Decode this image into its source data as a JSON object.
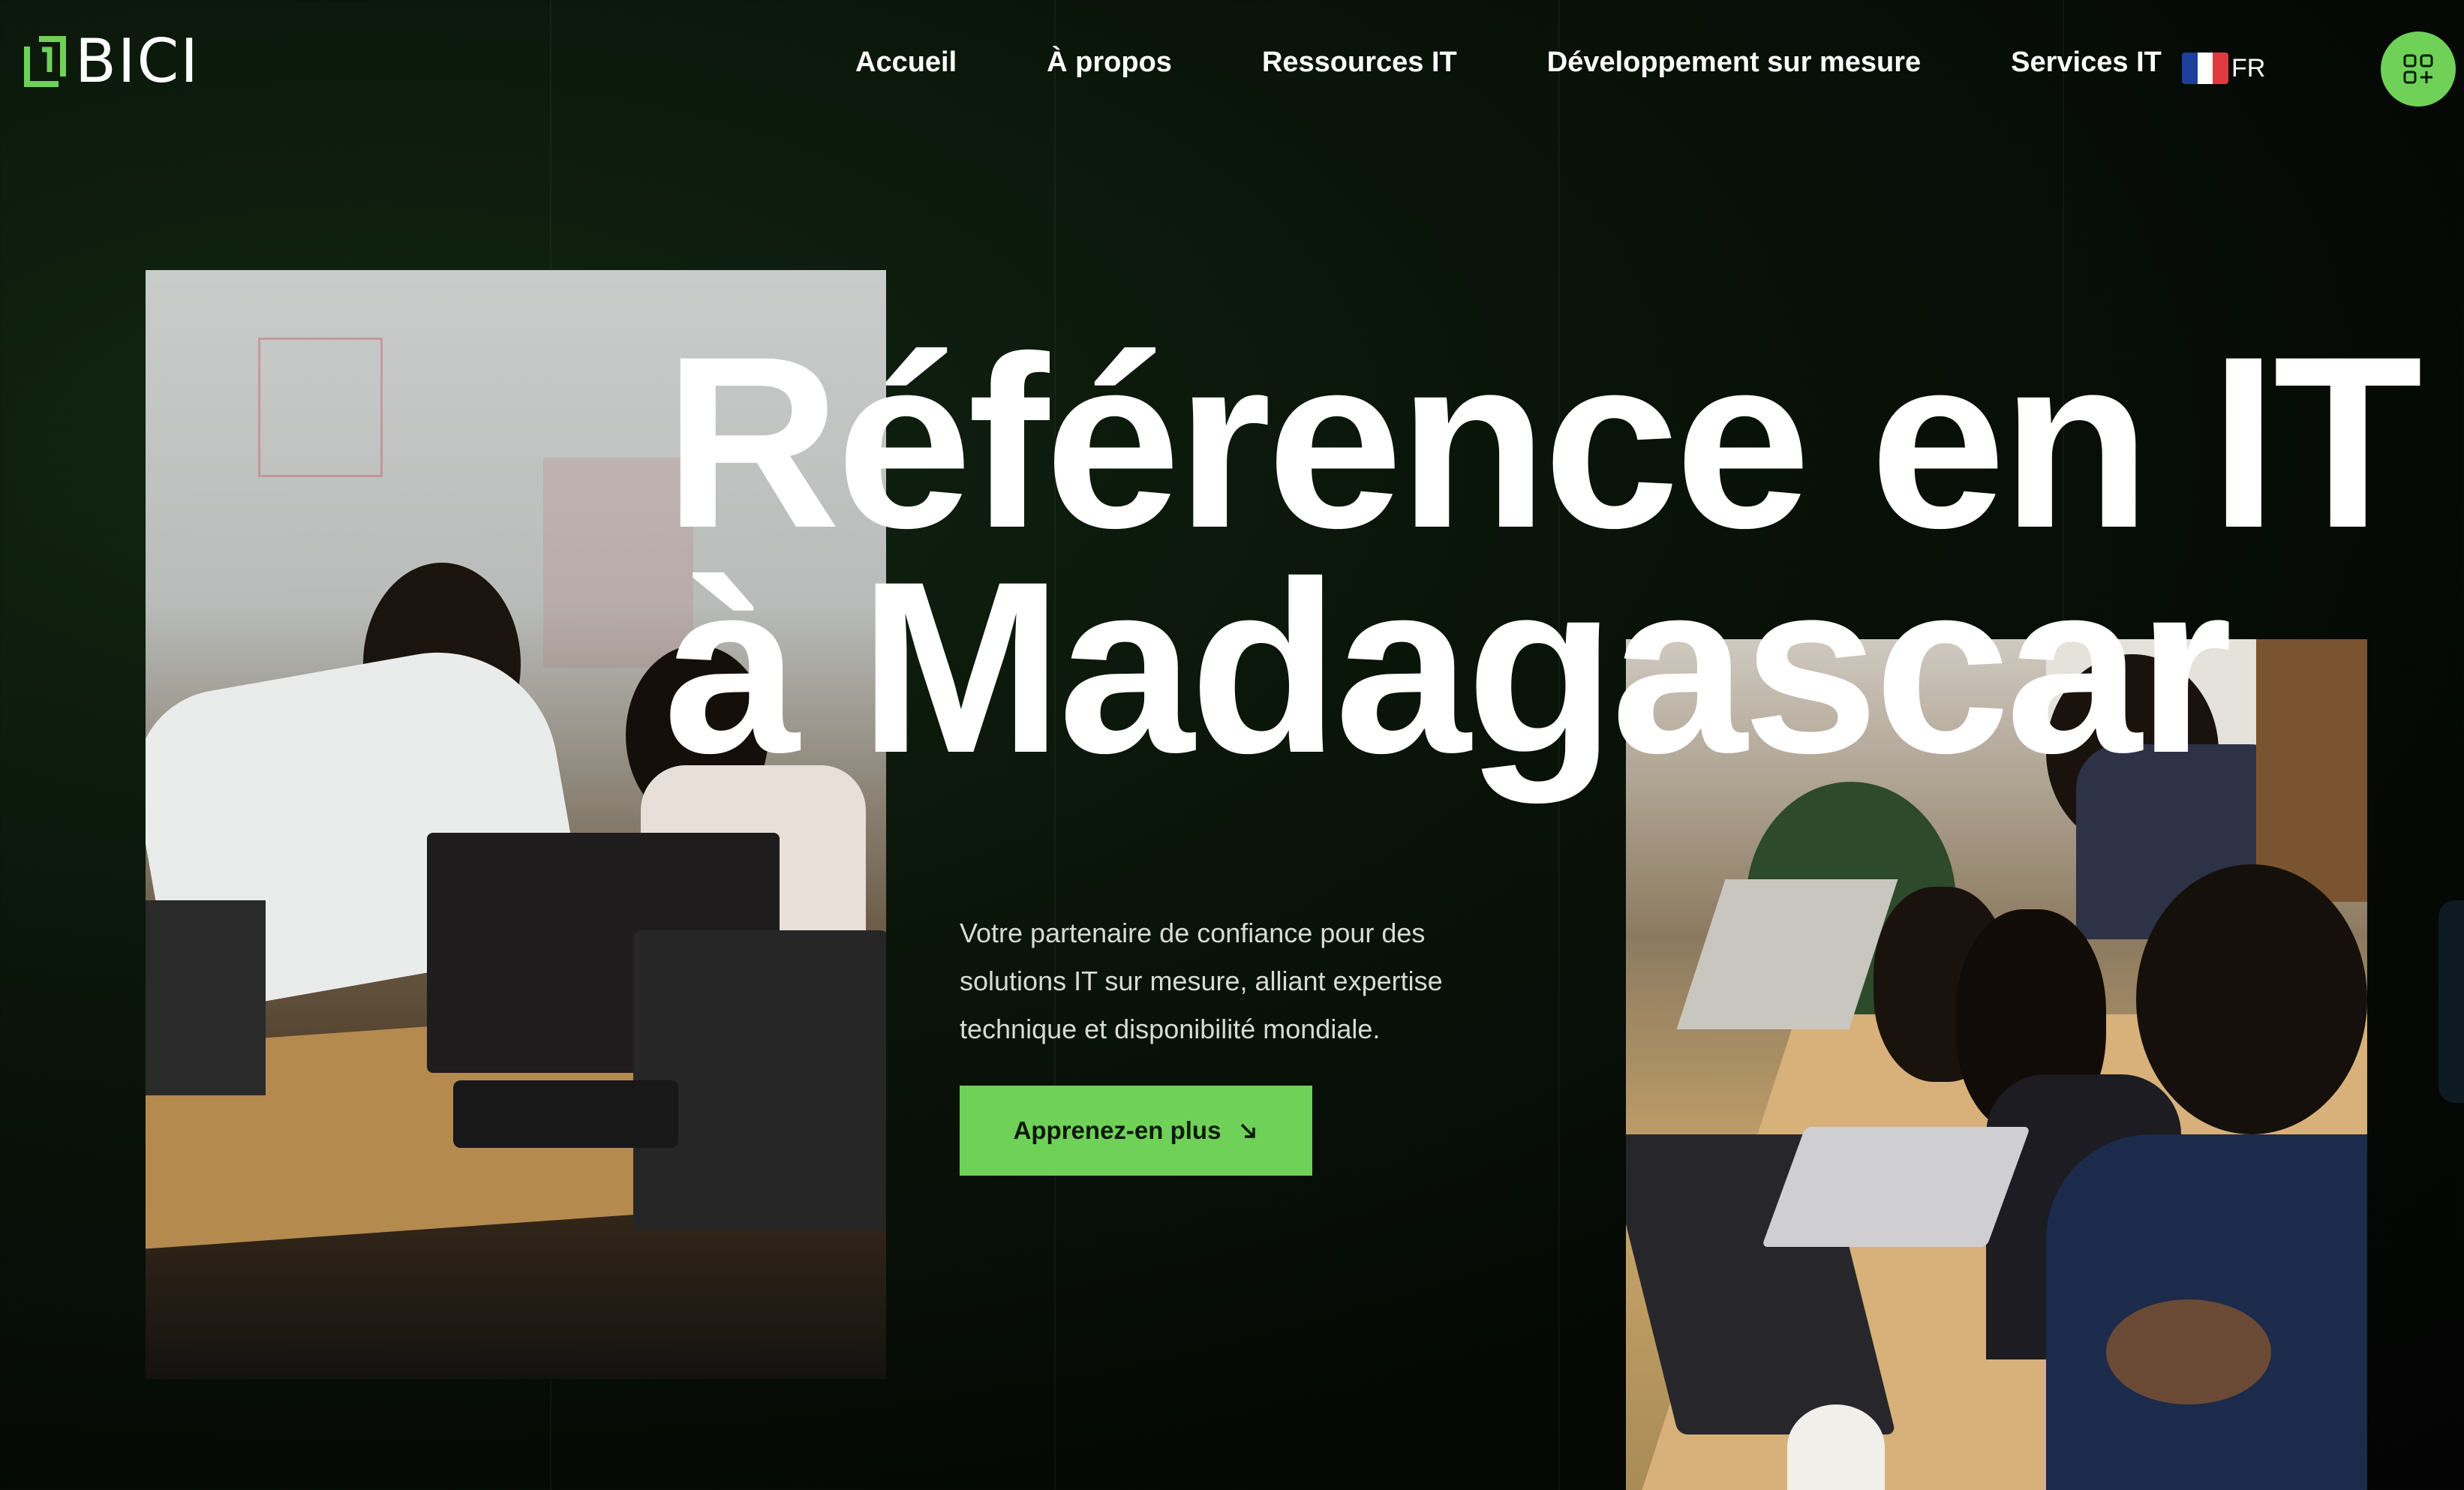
{
  "brand": {
    "name": "BICI",
    "logo_color": "#6fd158"
  },
  "nav": {
    "items": [
      {
        "label": "Accueil"
      },
      {
        "label": "À propos"
      },
      {
        "label": "Ressources IT"
      },
      {
        "label": "Développement sur mesure"
      },
      {
        "label": "Services IT"
      }
    ]
  },
  "language": {
    "code": "FR",
    "flag_colors": [
      "#1d3f9c",
      "#ffffff",
      "#e03a3e"
    ]
  },
  "menu_button": {
    "icon": "grid-plus-icon",
    "color": "#6fd158"
  },
  "hero": {
    "headline_line1": "Référence en IT",
    "headline_line2": "à Madagascar",
    "subtitle": "Votre partenaire de confiance pour des solutions IT sur mesure, alliant expertise technique et disponibilité mondiale.",
    "cta_label": "Apprenez-en plus",
    "cta_icon": "arrow-down-right-icon",
    "accent_color": "#6fd158"
  }
}
